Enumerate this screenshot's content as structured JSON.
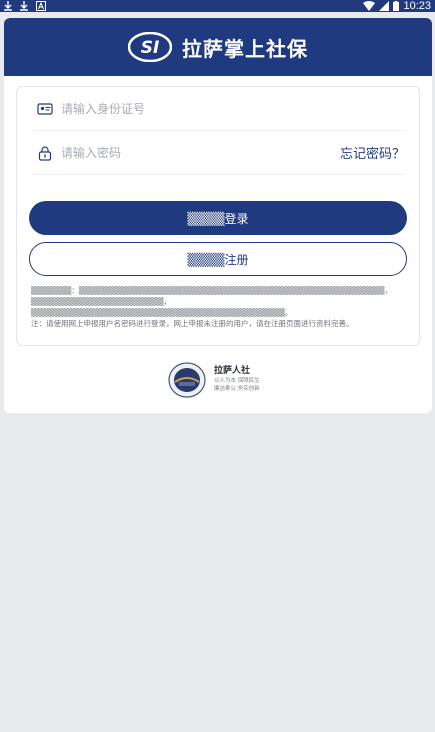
{
  "status_bar": {
    "left_icons": [
      "download-icon",
      "download-icon",
      "notification-a-icon"
    ],
    "right_icons": [
      "wifi-icon",
      "signal-icon",
      "battery-icon"
    ],
    "time": "10:23"
  },
  "header": {
    "logo_icon": "si-logo-icon",
    "title": "拉萨掌上社保"
  },
  "form": {
    "id_placeholder": "请输入身份证号",
    "password_placeholder": "请输入密码",
    "forgot_password": "忘记密码？",
    "login_button": "▒▒▒▒登录",
    "register_button": "▒▒▒▒注册"
  },
  "notice": {
    "line1": "▒▒▒▒▒▒▒：▒▒▒▒▒▒▒▒▒▒▒▒▒▒▒▒▒▒▒▒▒▒▒▒▒▒▒▒▒▒▒▒▒▒▒▒▒▒▒▒▒▒▒▒▒▒▒▒▒▒▒▒▒，▒▒▒▒▒▒▒▒▒▒▒▒▒▒▒▒▒▒▒▒▒▒▒，",
    "line2": "▒▒▒▒▒▒▒▒▒▒▒▒▒▒▒▒▒▒▒▒▒▒▒▒▒▒▒▒▒▒▒▒▒▒▒▒▒▒▒▒▒▒▒▒。",
    "line3": "注：请使用网上申报用户名密码进行登录，网上申报未注册的用户，请在注册页面进行资料完善。"
  },
  "footer": {
    "emblem_icon": "lhasa-hrss-emblem-icon",
    "title": "拉萨人社",
    "sub1": "以人为本 保障民生",
    "sub2": "廉洁奉公 务实创新"
  },
  "colors": {
    "primary": "#203a80",
    "background": "#e9eaee",
    "card": "#ffffff"
  }
}
